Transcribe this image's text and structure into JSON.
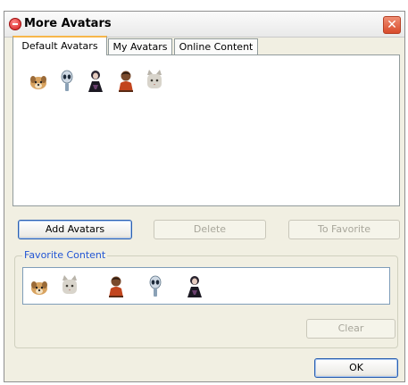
{
  "window": {
    "title": "More Avatars",
    "close_glyph": "✕"
  },
  "tabs": [
    {
      "label": "Default Avatars",
      "active": true
    },
    {
      "label": "My Avatars",
      "active": false
    },
    {
      "label": "Online Content",
      "active": false
    }
  ],
  "default_avatars": [
    {
      "icon": "dog-avatar-icon"
    },
    {
      "icon": "alien-avatar-icon"
    },
    {
      "icon": "dark-figure-avatar-icon"
    },
    {
      "icon": "man-avatar-icon"
    },
    {
      "icon": "cat-avatar-icon"
    }
  ],
  "buttons": {
    "add_avatars": "Add Avatars",
    "delete": "Delete",
    "to_favorite": "To Favorite",
    "clear": "Clear",
    "ok": "OK"
  },
  "favorites": {
    "legend": "Favorite Content",
    "items": [
      {
        "icon": "dog-avatar-icon"
      },
      {
        "icon": "cat-avatar-icon"
      },
      {
        "icon": "man-avatar-icon"
      },
      {
        "icon": "alien-avatar-icon"
      },
      {
        "icon": "dark-figure-avatar-icon"
      }
    ]
  },
  "colors": {
    "window_bg": "#f1efe2",
    "active_tab_accent": "#f7b64a",
    "group_legend": "#2155d4",
    "close_button": "#d84b2b"
  }
}
